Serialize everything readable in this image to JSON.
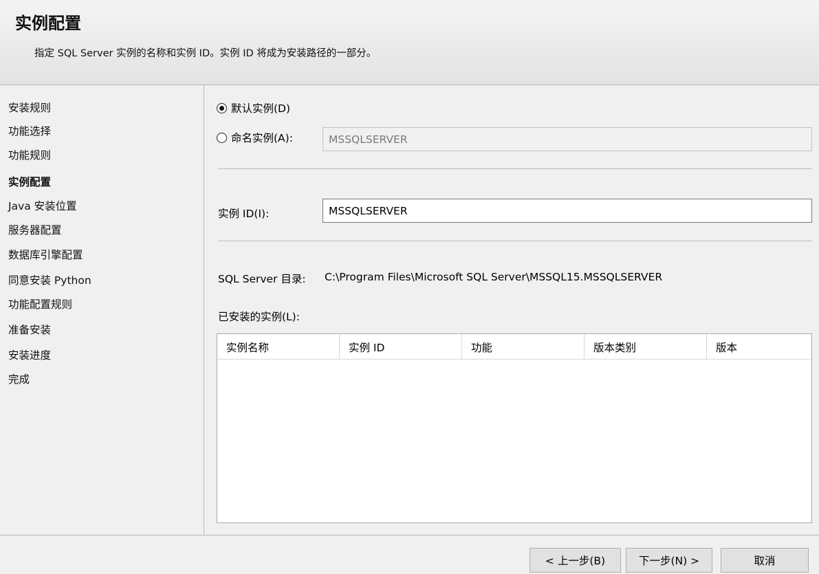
{
  "header": {
    "title": "实例配置",
    "description": "指定 SQL Server 实例的名称和实例 ID。实例 ID 将成为安装路径的一部分。"
  },
  "sidebar": {
    "steps": [
      {
        "label": "安装规则"
      },
      {
        "label": "功能选择"
      },
      {
        "label": "功能规则"
      },
      {
        "label": "实例配置",
        "active": true
      },
      {
        "label": "Java 安装位置"
      },
      {
        "label": "服务器配置"
      },
      {
        "label": "数据库引擎配置"
      },
      {
        "label": "同意安装 Python"
      },
      {
        "label": "功能配置规则"
      },
      {
        "label": "准备安装"
      },
      {
        "label": "安装进度"
      },
      {
        "label": "完成"
      }
    ]
  },
  "instance": {
    "default_label": "默认实例(D)",
    "named_label": "命名实例(A):",
    "named_value": "MSSQLSERVER",
    "selected": "default",
    "id_label": "实例 ID(I):",
    "id_value": "MSSQLSERVER",
    "dir_label": "SQL Server 目录:",
    "dir_value": "C:\\Program Files\\Microsoft SQL Server\\MSSQL15.MSSQLSERVER"
  },
  "installed": {
    "label": "已安装的实例(L):",
    "columns": [
      "实例名称",
      "实例 ID",
      "功能",
      "版本类别",
      "版本"
    ],
    "rows": []
  },
  "footer": {
    "back": "< 上一步(B)",
    "next": "下一步(N) >",
    "cancel": "取消"
  }
}
